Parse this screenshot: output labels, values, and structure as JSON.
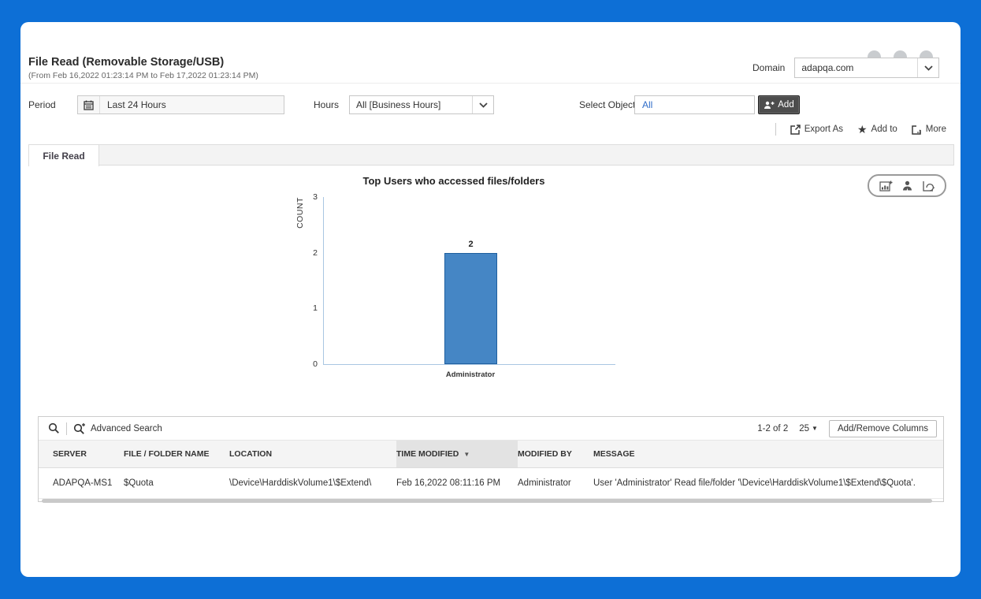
{
  "window": {
    "frame_color": "#0d6fd6"
  },
  "header": {
    "title": "File Read (Removable Storage/USB)",
    "subtitle": "(From Feb 16,2022 01:23:14 PM to Feb 17,2022 01:23:14 PM)",
    "domain_label": "Domain",
    "domain_value": "adapqa.com"
  },
  "filters": {
    "period_label": "Period",
    "period_value": "Last 24 Hours",
    "hours_label": "Hours",
    "hours_value": "All [Business Hours]",
    "select_objects_label": "Select Objects",
    "select_objects_value": "All",
    "add_button_label": "Add"
  },
  "actions": {
    "export_as": "Export As",
    "add_to": "Add to",
    "more": "More"
  },
  "tabs": [
    {
      "label": "File Read",
      "active": true
    }
  ],
  "chart_data": {
    "type": "bar",
    "title": "Top Users who accessed files/folders",
    "categories": [
      "Administrator"
    ],
    "values": [
      2
    ],
    "series": [
      {
        "name": "COUNT",
        "values": [
          2
        ]
      }
    ],
    "xlabel": "",
    "ylabel": "COUNT",
    "ylim": [
      0,
      3
    ],
    "yticks": [
      0,
      1,
      2,
      3
    ],
    "grid": false,
    "legend": "none",
    "bar_color": "#4586c5",
    "bar_border": "#1f5f9f",
    "axis_color": "#a9c6e2"
  },
  "table": {
    "toolbar": {
      "advanced_search_label": "Advanced Search",
      "pagination_range": "1-2 of 2",
      "page_size": "25",
      "columns_button_label": "Add/Remove Columns"
    },
    "headers": [
      "SERVER",
      "FILE / FOLDER NAME",
      "LOCATION",
      "TIME MODIFIED",
      "MODIFIED BY",
      "MESSAGE"
    ],
    "sorted_column": "TIME MODIFIED",
    "sort_direction": "desc",
    "rows": [
      [
        "ADAPQA-MS1",
        "$Quota",
        "\\Device\\HarddiskVolume1\\$Extend\\",
        "Feb 16,2022 08:11:16 PM",
        "Administrator",
        "User 'Administrator' Read file/folder '\\Device\\HarddiskVolume1\\$Extend\\$Quota'."
      ]
    ]
  },
  "icons": [
    "calendar-icon",
    "chevron-down-icon",
    "person-add-icon",
    "export-icon",
    "star-icon",
    "more-icon",
    "chart-add-icon",
    "user-icon",
    "chart-refresh-icon",
    "search-icon",
    "advanced-search-icon",
    "sort-desc-icon",
    "caret-down-icon"
  ]
}
